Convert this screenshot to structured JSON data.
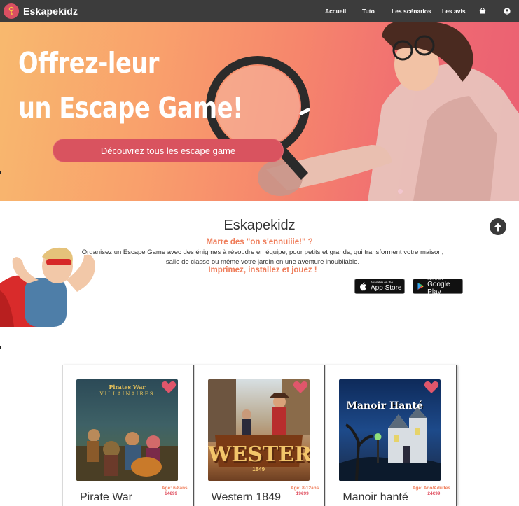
{
  "nav": {
    "brand": "Eskapekidz",
    "links": [
      "Accueil",
      "Tuto",
      "Les scénarios",
      "Les avis"
    ],
    "icons": [
      "basket-icon",
      "user-icon"
    ]
  },
  "hero": {
    "title_line1": "Offrez-leur",
    "title_line2": "un Escape Game!",
    "button": "Découvrez tous les escape game"
  },
  "intro": {
    "title": "Eskapekidz",
    "tagline": "Marre des \"on s'ennuiiie!\" ?",
    "description_line1": "Organisez un Escape Game avec des énigmes à résoudre en équipe, pour petits et grands, qui transforment votre maison,",
    "description_line2": "salle de classe ou même votre jardin en une aventure inoubliable.",
    "cta": "Imprimez, installez et jouez !"
  },
  "stores": {
    "apple_small": "Available on the",
    "apple_big": "App Store",
    "google_small": "GET IT ON",
    "google_big": "Google Play"
  },
  "products": [
    {
      "name": "Pirate War",
      "age": "Age: 6-8ans",
      "price": "14€99",
      "image_text": "Pirates War",
      "image_subtext": "VILLAINAIRES"
    },
    {
      "name": "Western 1849",
      "age": "Age: 8-12ans",
      "price": "19€99",
      "image_text": "WESTERN",
      "image_subtext": "1849"
    },
    {
      "name": "Manoir hanté",
      "age": "Age: Ado/Adultes",
      "price": "24€99",
      "image_text": "Manoir Hanté",
      "image_subtext": ""
    }
  ],
  "colors": {
    "navbar": "#3c3c3c",
    "accent": "#ef7d5a",
    "button": "#d9535f",
    "price": "#e05363",
    "heart": "#e0566b"
  }
}
